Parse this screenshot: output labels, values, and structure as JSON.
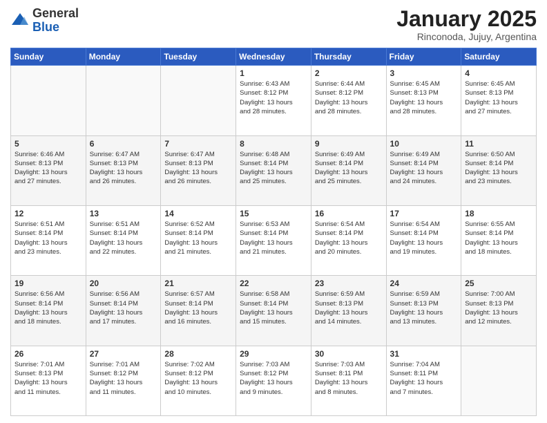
{
  "logo": {
    "general": "General",
    "blue": "Blue"
  },
  "title": {
    "month": "January 2025",
    "location": "Rinconoda, Jujuy, Argentina"
  },
  "days_header": [
    "Sunday",
    "Monday",
    "Tuesday",
    "Wednesday",
    "Thursday",
    "Friday",
    "Saturday"
  ],
  "weeks": [
    [
      {
        "day": "",
        "info": ""
      },
      {
        "day": "",
        "info": ""
      },
      {
        "day": "",
        "info": ""
      },
      {
        "day": "1",
        "info": "Sunrise: 6:43 AM\nSunset: 8:12 PM\nDaylight: 13 hours\nand 28 minutes."
      },
      {
        "day": "2",
        "info": "Sunrise: 6:44 AM\nSunset: 8:12 PM\nDaylight: 13 hours\nand 28 minutes."
      },
      {
        "day": "3",
        "info": "Sunrise: 6:45 AM\nSunset: 8:13 PM\nDaylight: 13 hours\nand 28 minutes."
      },
      {
        "day": "4",
        "info": "Sunrise: 6:45 AM\nSunset: 8:13 PM\nDaylight: 13 hours\nand 27 minutes."
      }
    ],
    [
      {
        "day": "5",
        "info": "Sunrise: 6:46 AM\nSunset: 8:13 PM\nDaylight: 13 hours\nand 27 minutes."
      },
      {
        "day": "6",
        "info": "Sunrise: 6:47 AM\nSunset: 8:13 PM\nDaylight: 13 hours\nand 26 minutes."
      },
      {
        "day": "7",
        "info": "Sunrise: 6:47 AM\nSunset: 8:13 PM\nDaylight: 13 hours\nand 26 minutes."
      },
      {
        "day": "8",
        "info": "Sunrise: 6:48 AM\nSunset: 8:14 PM\nDaylight: 13 hours\nand 25 minutes."
      },
      {
        "day": "9",
        "info": "Sunrise: 6:49 AM\nSunset: 8:14 PM\nDaylight: 13 hours\nand 25 minutes."
      },
      {
        "day": "10",
        "info": "Sunrise: 6:49 AM\nSunset: 8:14 PM\nDaylight: 13 hours\nand 24 minutes."
      },
      {
        "day": "11",
        "info": "Sunrise: 6:50 AM\nSunset: 8:14 PM\nDaylight: 13 hours\nand 23 minutes."
      }
    ],
    [
      {
        "day": "12",
        "info": "Sunrise: 6:51 AM\nSunset: 8:14 PM\nDaylight: 13 hours\nand 23 minutes."
      },
      {
        "day": "13",
        "info": "Sunrise: 6:51 AM\nSunset: 8:14 PM\nDaylight: 13 hours\nand 22 minutes."
      },
      {
        "day": "14",
        "info": "Sunrise: 6:52 AM\nSunset: 8:14 PM\nDaylight: 13 hours\nand 21 minutes."
      },
      {
        "day": "15",
        "info": "Sunrise: 6:53 AM\nSunset: 8:14 PM\nDaylight: 13 hours\nand 21 minutes."
      },
      {
        "day": "16",
        "info": "Sunrise: 6:54 AM\nSunset: 8:14 PM\nDaylight: 13 hours\nand 20 minutes."
      },
      {
        "day": "17",
        "info": "Sunrise: 6:54 AM\nSunset: 8:14 PM\nDaylight: 13 hours\nand 19 minutes."
      },
      {
        "day": "18",
        "info": "Sunrise: 6:55 AM\nSunset: 8:14 PM\nDaylight: 13 hours\nand 18 minutes."
      }
    ],
    [
      {
        "day": "19",
        "info": "Sunrise: 6:56 AM\nSunset: 8:14 PM\nDaylight: 13 hours\nand 18 minutes."
      },
      {
        "day": "20",
        "info": "Sunrise: 6:56 AM\nSunset: 8:14 PM\nDaylight: 13 hours\nand 17 minutes."
      },
      {
        "day": "21",
        "info": "Sunrise: 6:57 AM\nSunset: 8:14 PM\nDaylight: 13 hours\nand 16 minutes."
      },
      {
        "day": "22",
        "info": "Sunrise: 6:58 AM\nSunset: 8:14 PM\nDaylight: 13 hours\nand 15 minutes."
      },
      {
        "day": "23",
        "info": "Sunrise: 6:59 AM\nSunset: 8:13 PM\nDaylight: 13 hours\nand 14 minutes."
      },
      {
        "day": "24",
        "info": "Sunrise: 6:59 AM\nSunset: 8:13 PM\nDaylight: 13 hours\nand 13 minutes."
      },
      {
        "day": "25",
        "info": "Sunrise: 7:00 AM\nSunset: 8:13 PM\nDaylight: 13 hours\nand 12 minutes."
      }
    ],
    [
      {
        "day": "26",
        "info": "Sunrise: 7:01 AM\nSunset: 8:13 PM\nDaylight: 13 hours\nand 11 minutes."
      },
      {
        "day": "27",
        "info": "Sunrise: 7:01 AM\nSunset: 8:12 PM\nDaylight: 13 hours\nand 11 minutes."
      },
      {
        "day": "28",
        "info": "Sunrise: 7:02 AM\nSunset: 8:12 PM\nDaylight: 13 hours\nand 10 minutes."
      },
      {
        "day": "29",
        "info": "Sunrise: 7:03 AM\nSunset: 8:12 PM\nDaylight: 13 hours\nand 9 minutes."
      },
      {
        "day": "30",
        "info": "Sunrise: 7:03 AM\nSunset: 8:11 PM\nDaylight: 13 hours\nand 8 minutes."
      },
      {
        "day": "31",
        "info": "Sunrise: 7:04 AM\nSunset: 8:11 PM\nDaylight: 13 hours\nand 7 minutes."
      },
      {
        "day": "",
        "info": ""
      }
    ]
  ]
}
